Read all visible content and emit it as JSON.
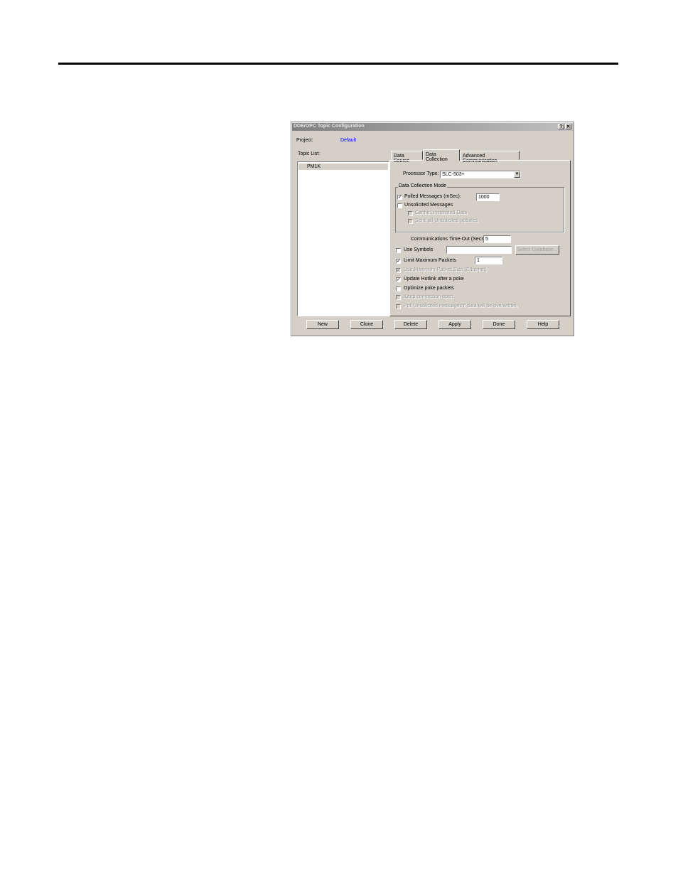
{
  "dialog": {
    "title": "DDE/OPC Topic Configuration",
    "help_glyph": "?",
    "close_glyph": "✕",
    "project_label": "Project:",
    "project_value": "Default",
    "project_color": "#0000ff",
    "topic_list_label": "Topic List:",
    "topics": [
      "PM1K"
    ],
    "tabs": [
      {
        "label": "Data Source",
        "active": false
      },
      {
        "label": "Data Collection",
        "active": true
      },
      {
        "label": "Advanced Communication",
        "active": false
      }
    ],
    "processor_type_label": "Processor Type:",
    "processor_type_value": "SLC-503+",
    "combo_arrow": "▼",
    "data_collection_mode_label": "Data Collection Mode",
    "polled_messages_label": "Polled Messages (mSec):",
    "polled_messages_value": "1000",
    "unsolicited_messages_label": "Unsolicited Messages",
    "cache_unsolicited_label": "Cache Unsolicited Data",
    "send_all_unsolicited_label": "Send all Unsolicited updates",
    "comm_timeout_label": "Communications Time-Out (Secs):",
    "comm_timeout_value": "5",
    "use_symbols_label": "Use Symbols",
    "select_database_label": "Select Database...",
    "limit_max_packets_label": "Limit Maximum Packets",
    "limit_max_packets_value": "1",
    "use_max_packet_size_label": "Use Maximum Packet Size (Ethernet)",
    "update_hotlink_label": "Update Hotlink after a poke",
    "optimize_poke_label": "Optimize poke packets",
    "keep_connection_label": "Keep connection open",
    "poll_unsolicited_label": "Poll Unsolicited messages if data will be overwritten",
    "check_glyph": "✓",
    "buttons": {
      "new": "New",
      "clone": "Clone",
      "delete": "Delete",
      "apply": "Apply",
      "done": "Done",
      "help": "Help"
    }
  }
}
